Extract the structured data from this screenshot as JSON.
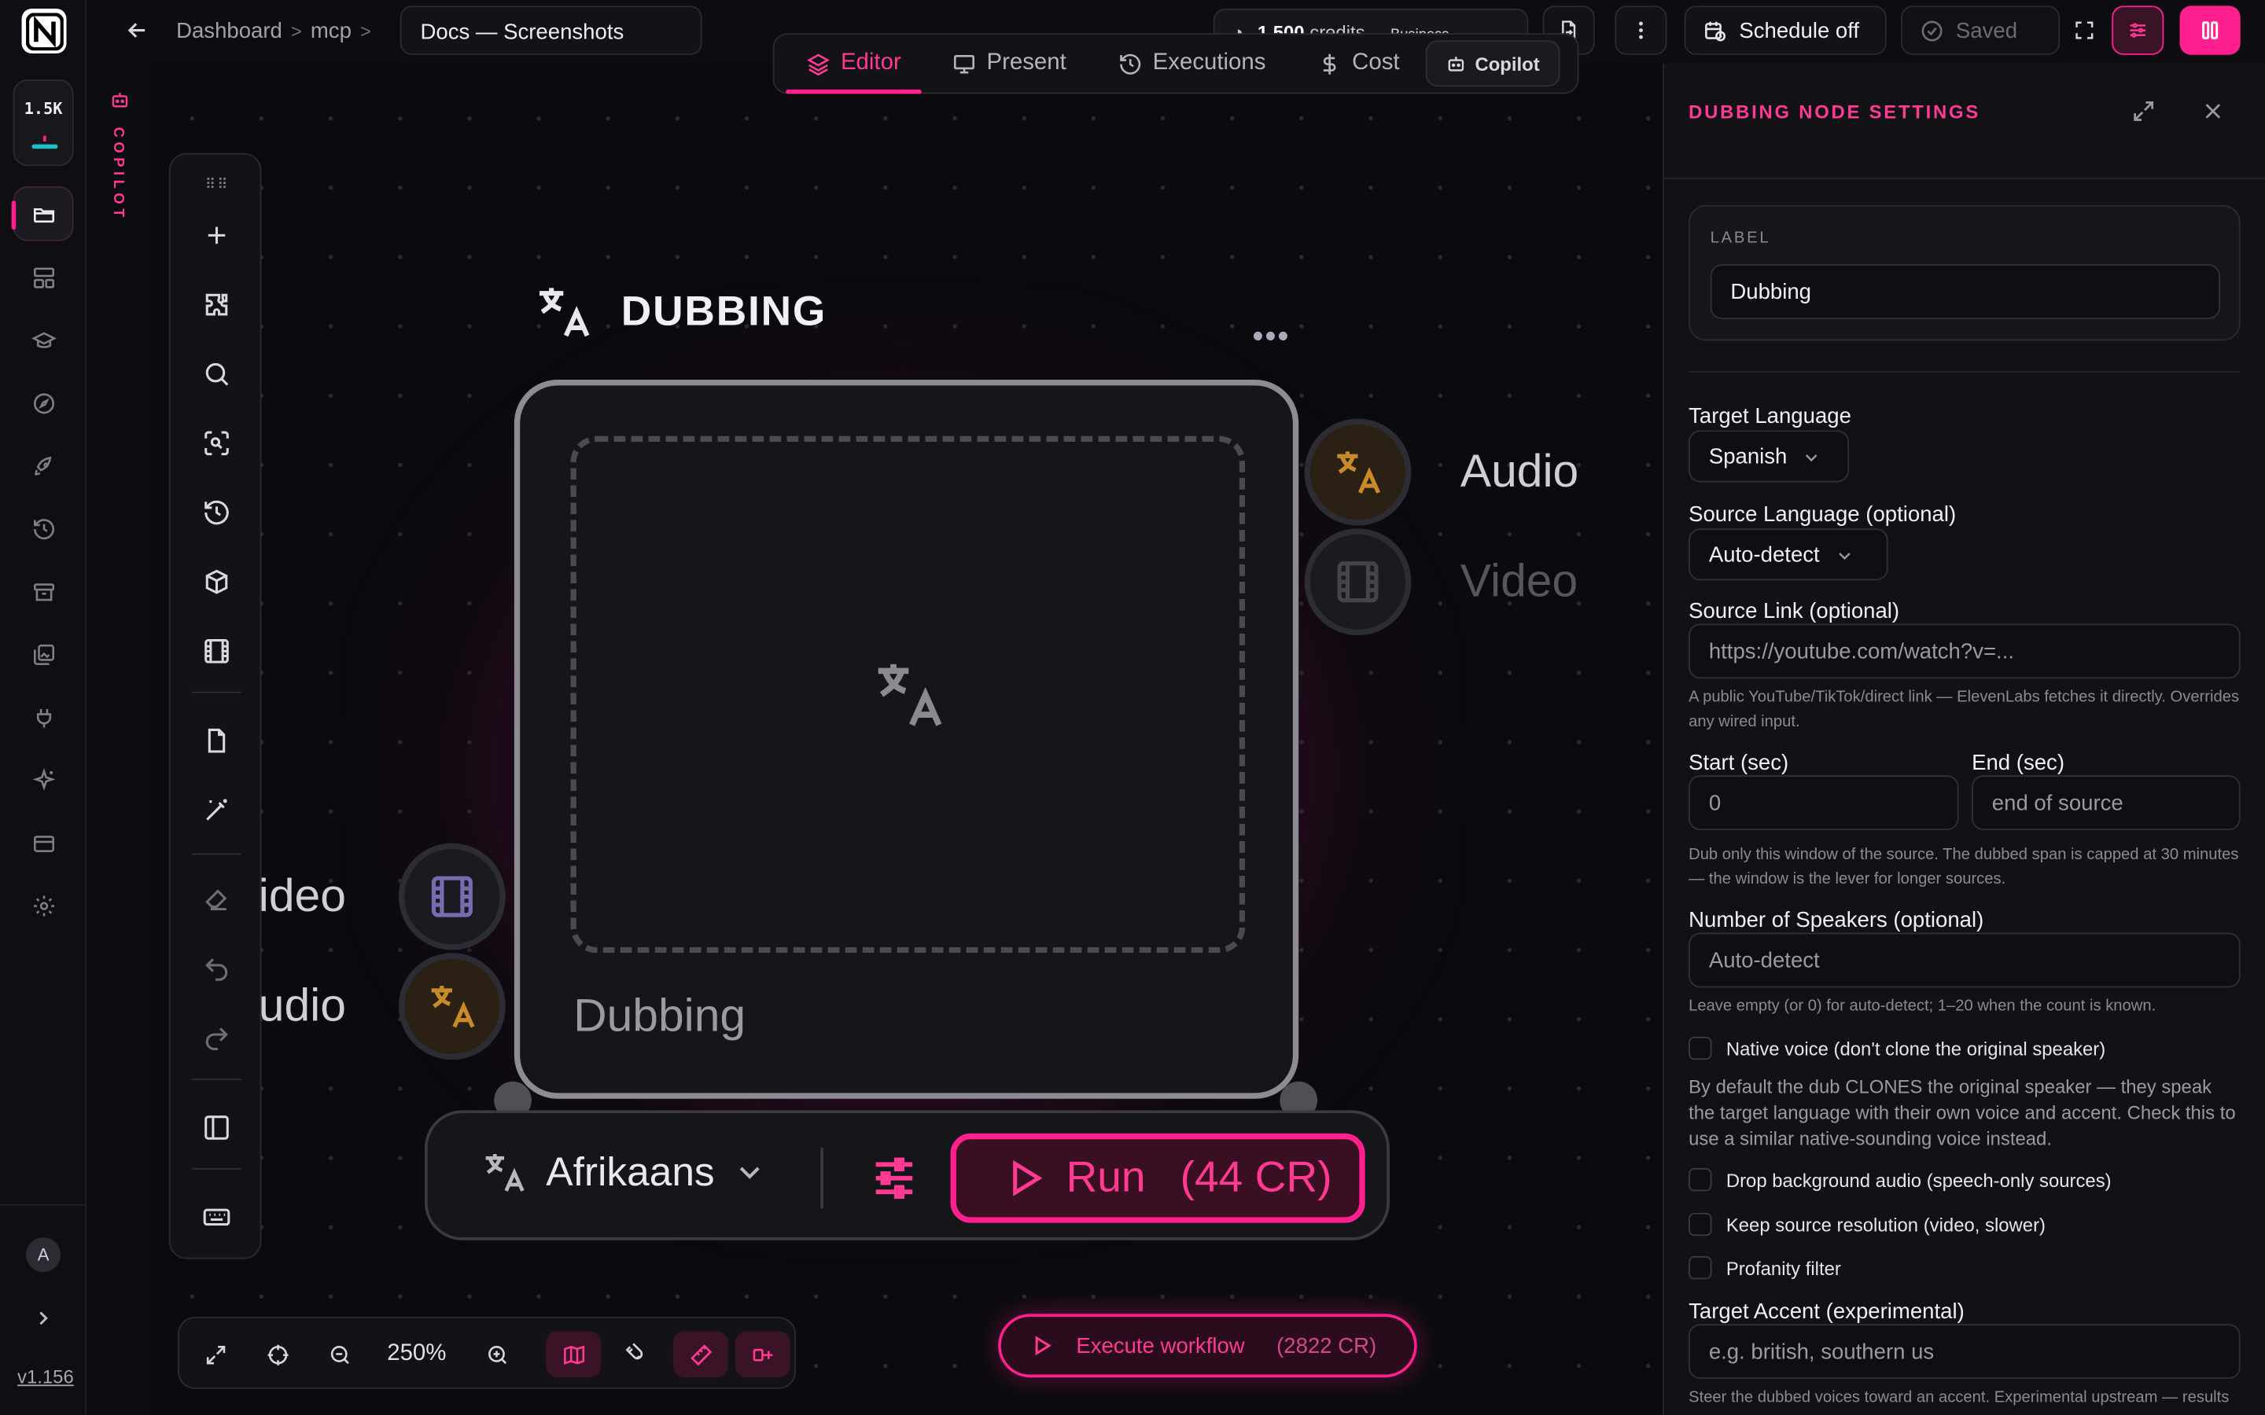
{
  "rail": {
    "credits": "1.5K",
    "version": "v1.156",
    "avatar_initial": "A"
  },
  "copilot_strip": {
    "label": "COPILOT"
  },
  "topbar": {
    "breadcrumbs": [
      "Dashboard",
      "mcp"
    ],
    "doc_title": "Docs — Screenshots",
    "credits_value": "1,500",
    "credits_word": "credits",
    "plan": "Business",
    "schedule_label": "Schedule off",
    "saved_label": "Saved"
  },
  "mode_tabs": [
    {
      "label": "Editor",
      "active": true
    },
    {
      "label": "Present",
      "active": false
    },
    {
      "label": "Executions",
      "active": false
    },
    {
      "label": "Cost",
      "active": false
    }
  ],
  "copilot_tab": "Copilot",
  "node": {
    "title": "DUBBING",
    "label": "Dubbing",
    "outputs": [
      "Audio",
      "Video"
    ],
    "inputs": [
      "ideo",
      "udio"
    ],
    "language": "Afrikaans",
    "run_label": "Run",
    "run_cost": "(44 CR)"
  },
  "zoom": {
    "level": "250%"
  },
  "execute": {
    "label": "Execute workflow",
    "cost": "(2822 CR)"
  },
  "panel": {
    "title": "DUBBING NODE SETTINGS",
    "label_caption": "LABEL",
    "label_value": "Dubbing",
    "target_language_label": "Target Language",
    "target_language_value": "Spanish",
    "source_language_label": "Source Language (optional)",
    "source_language_value": "Auto-detect",
    "source_link_label": "Source Link (optional)",
    "source_link_placeholder": "https://youtube.com/watch?v=...",
    "source_link_help": "A public YouTube/TikTok/direct link — ElevenLabs fetches it directly. Overrides any wired input.",
    "start_label": "Start (sec)",
    "start_value": "0",
    "end_label": "End (sec)",
    "end_placeholder": "end of source",
    "window_help": "Dub only this window of the source. The dubbed span is capped at 30 minutes — the window is the lever for longer sources.",
    "speakers_label": "Number of Speakers (optional)",
    "speakers_placeholder": "Auto-detect",
    "speakers_help": "Leave empty (or 0) for auto-detect; 1–20 when the count is known.",
    "native_voice_label": "Native voice (don't clone the original speaker)",
    "native_voice_help": "By default the dub CLONES the original speaker — they speak the target language with their own voice and accent. Check this to use a similar native-sounding voice instead.",
    "drop_bg_label": "Drop background audio (speech-only sources)",
    "keep_res_label": "Keep source resolution (video, slower)",
    "profanity_label": "Profanity filter",
    "accent_label": "Target Accent (experimental)",
    "accent_placeholder": "e.g. british, southern us",
    "accent_help": "Steer the dubbed voices toward an accent. Experimental upstream — results"
  },
  "colors": {
    "accent": "#ff1f8e",
    "teal": "#19c2c9",
    "orange": "#c98a2a"
  }
}
